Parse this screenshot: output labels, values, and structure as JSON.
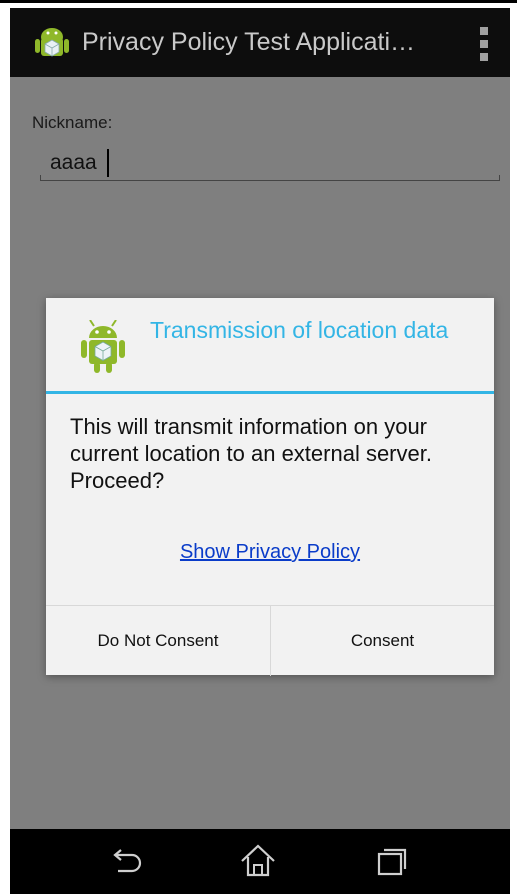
{
  "action_bar": {
    "title": "Privacy Policy Test Applicati…",
    "app_icon": "android-robot-icon",
    "overflow_icon": "overflow-menu-icon"
  },
  "form": {
    "nickname_label": "Nickname:",
    "nickname_value": "aaaa"
  },
  "dialog": {
    "icon": "android-robot-icon",
    "title": "Transmission of location data",
    "message": "This will transmit information on your current location to an external server. Proceed?",
    "link": "Show Privacy Policy",
    "buttons": {
      "negative": "Do Not Consent",
      "positive": "Consent"
    }
  },
  "nav_bar": {
    "back_icon": "back-icon",
    "home_icon": "home-icon",
    "recent_icon": "recent-apps-icon"
  },
  "colors": {
    "accent": "#33b5e5",
    "link": "#0a3cc9",
    "action_bar": "#0d0d0d",
    "scrim": "#7f7f7f"
  }
}
